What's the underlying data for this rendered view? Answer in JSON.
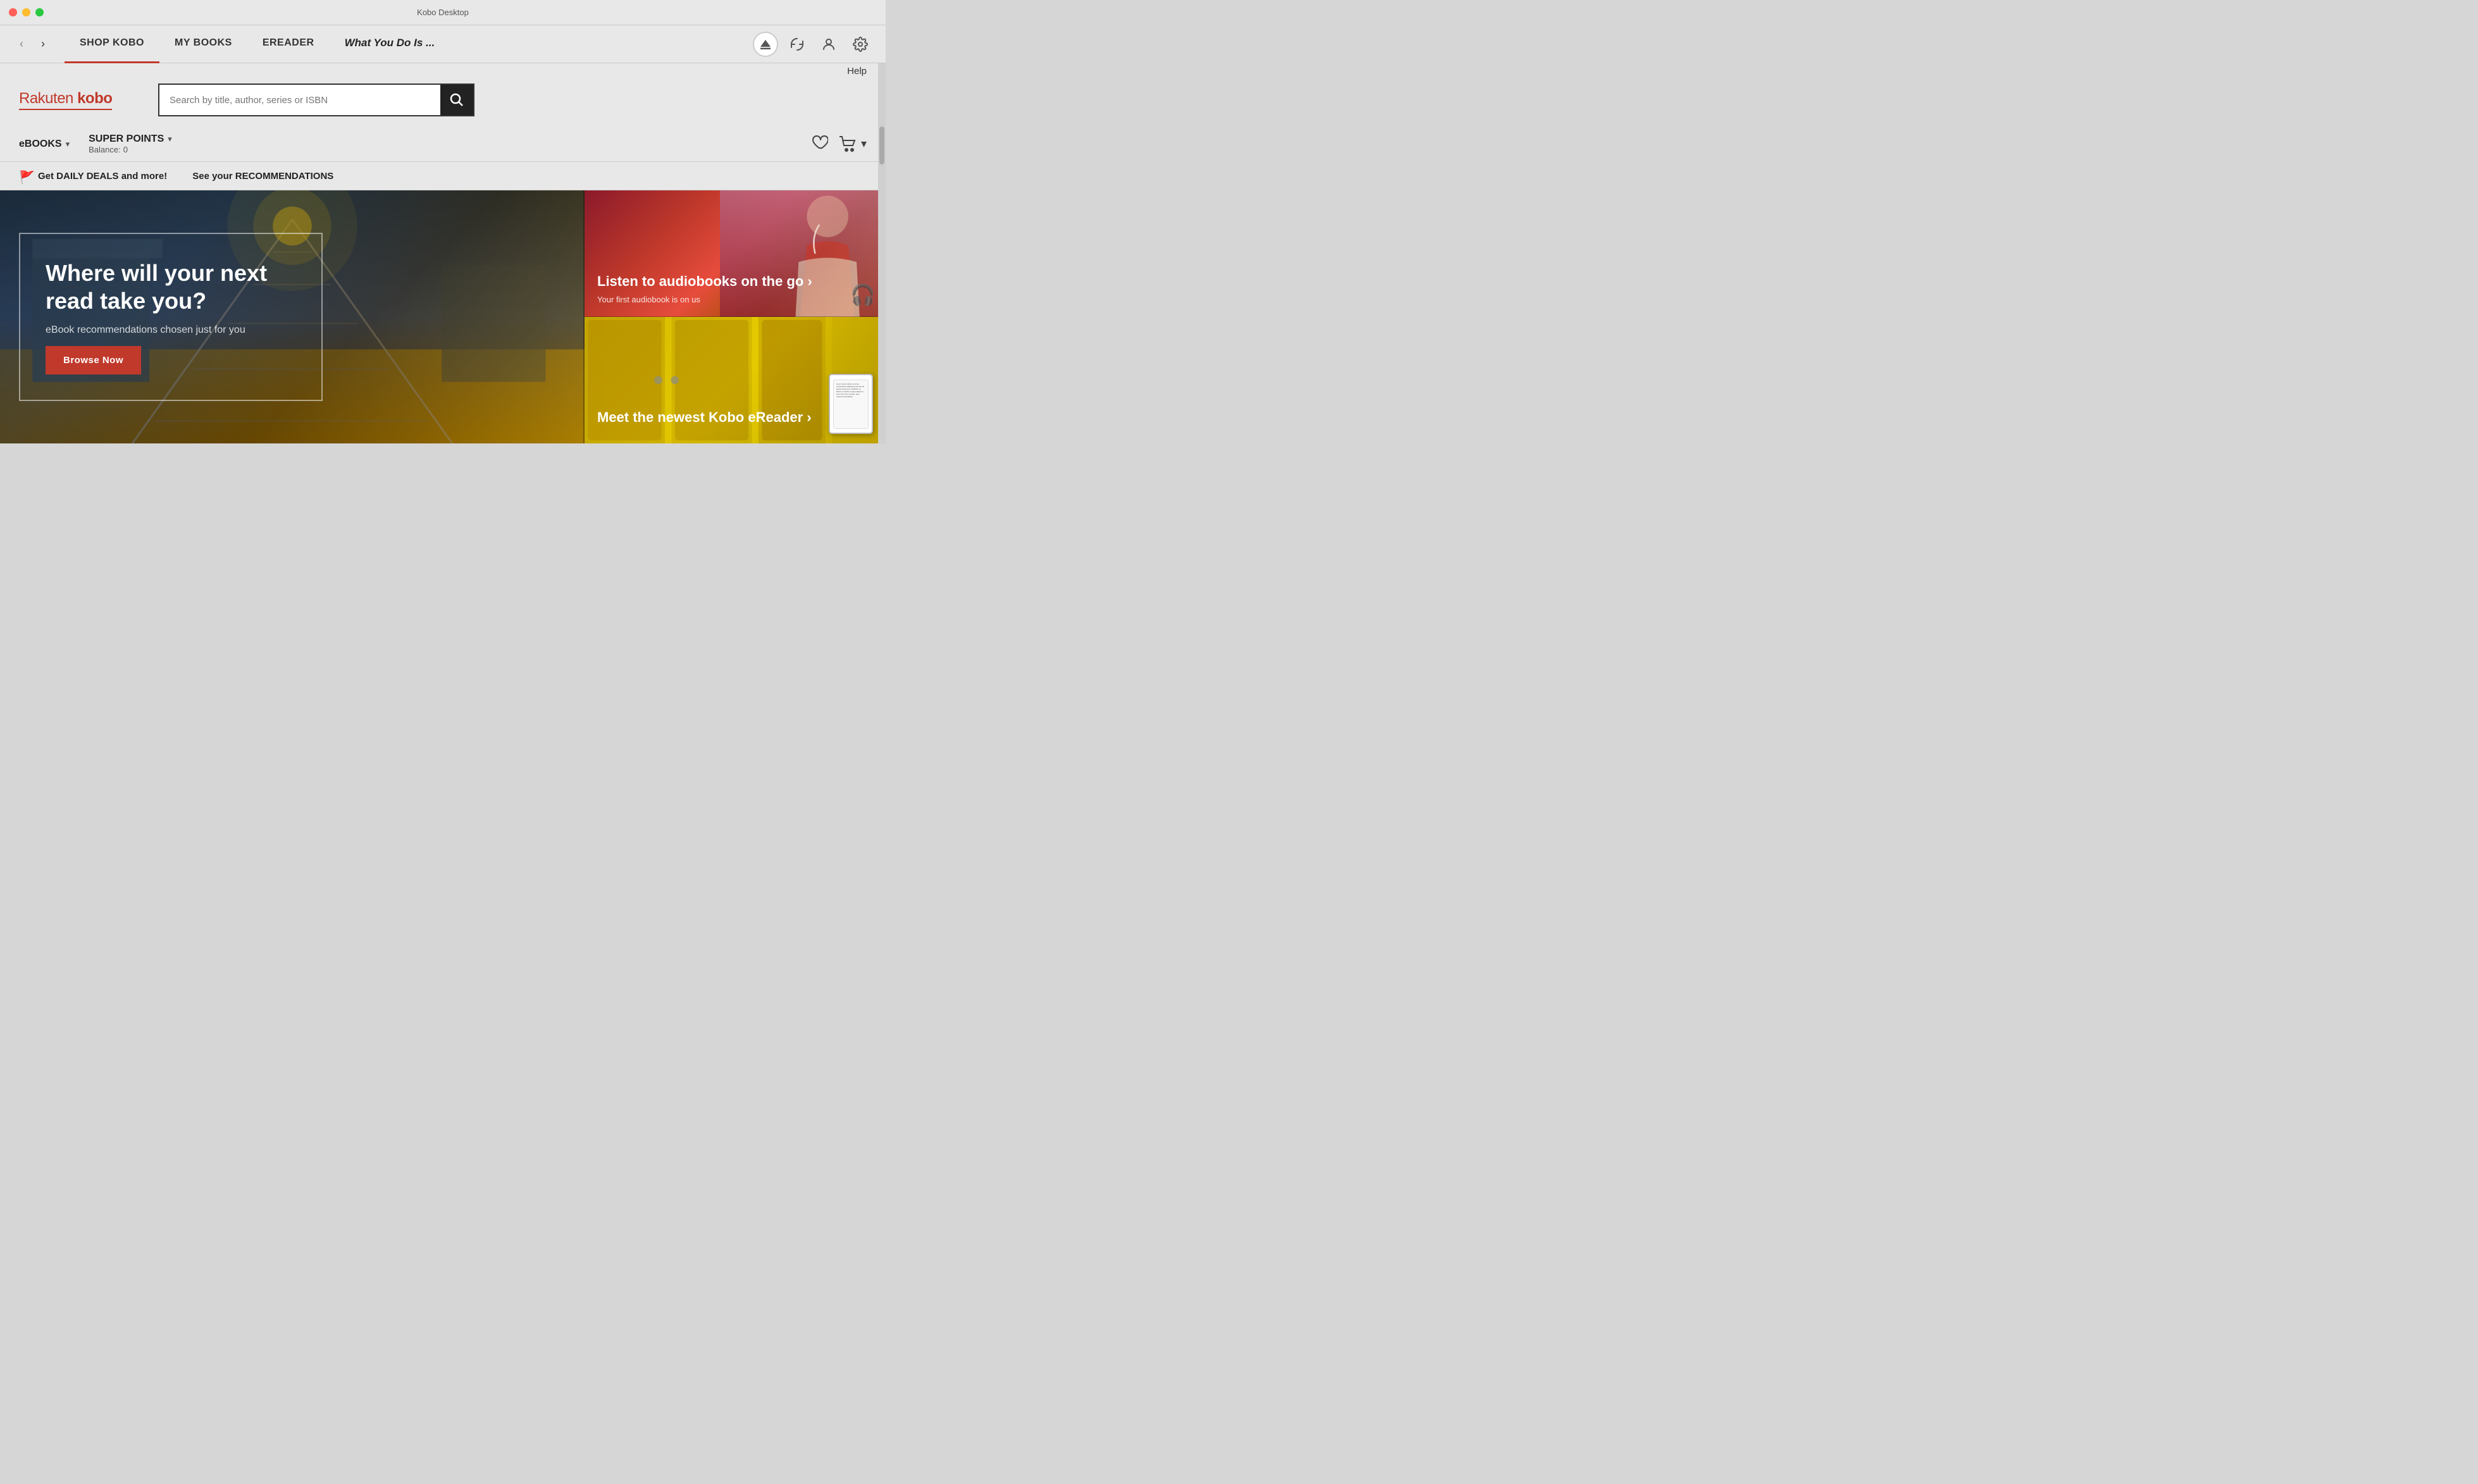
{
  "window": {
    "title": "Kobo Desktop"
  },
  "navbar": {
    "back_label": "‹",
    "forward_label": "›",
    "tabs": [
      {
        "id": "shop",
        "label": "SHOP KOBO",
        "active": true
      },
      {
        "id": "mybooks",
        "label": "MY BOOKS",
        "active": false
      },
      {
        "id": "ereader",
        "label": "EREADER",
        "active": false
      },
      {
        "id": "reading",
        "label": "What You Do Is ...",
        "active": false,
        "italic": true
      }
    ],
    "icons": {
      "eject_label": "⏏",
      "sync_label": "↻",
      "account_label": "👤",
      "settings_label": "⚙"
    }
  },
  "help": {
    "label": "Help"
  },
  "logo": {
    "text": "Rakuten kobo"
  },
  "search": {
    "placeholder": "Search by title, author, series or ISBN",
    "button_label": "🔍"
  },
  "secondary_nav": {
    "ebooks": {
      "label": "eBOOKS",
      "chevron": "▾"
    },
    "super_points": {
      "label": "SUPER POINTS",
      "chevron": "▾",
      "balance_label": "Balance:",
      "balance_value": "0"
    },
    "wishlist_icon": "♡",
    "cart_icon": "🛒",
    "cart_chevron": "▾"
  },
  "promo_bar": {
    "items": [
      {
        "id": "deals",
        "flag": "🚩",
        "text": "Get DAILY DEALS and more!"
      },
      {
        "id": "recs",
        "text": "See your RECOMMENDATIONS"
      }
    ]
  },
  "hero": {
    "title": "Where will your next read take you?",
    "subtitle": "eBook recommendations chosen just for you",
    "button_label": "Browse Now"
  },
  "side_banners": [
    {
      "id": "audiobooks",
      "title": "Listen to audiobooks on the go ›",
      "subtitle": "Your first audiobook is on us",
      "icon": "🎧"
    },
    {
      "id": "ereader",
      "title": "Meet the newest Kobo eReader ›",
      "subtitle": ""
    }
  ],
  "colors": {
    "brand_red": "#c0392b",
    "nav_underline": "#c0392b",
    "bg_light": "#e8e8e8",
    "bg_dark": "#222222"
  }
}
